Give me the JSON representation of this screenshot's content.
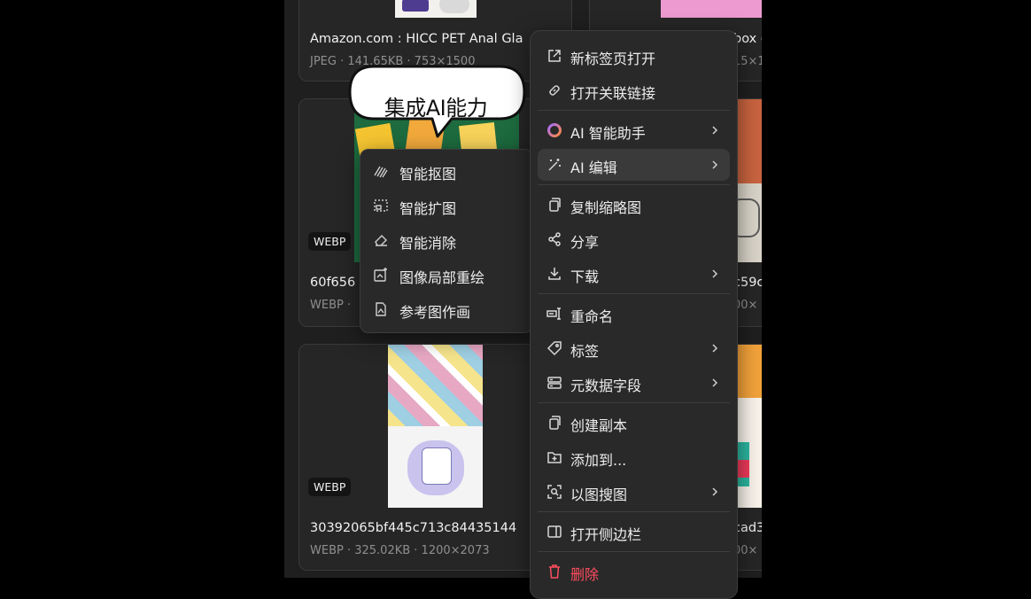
{
  "cards": [
    {
      "title": "Amazon.com : HICC PET Anal Gla",
      "meta": "JPEG · 141.65KB · 753×1500"
    },
    {
      "title": "60f656",
      "meta": "WEBP ·",
      "badge": "WEBP"
    },
    {
      "title": "30392065bf445c713c84435144",
      "meta": "WEBP · 325.02KB · 1200×2073",
      "badge": "WEBP"
    },
    {
      "title": "box c",
      "meta": "15×1"
    },
    {
      "title": "c59c",
      "meta": "00×"
    },
    {
      "title": "cad3",
      "meta": "00×"
    }
  ],
  "tooltip": {
    "label": "集成AI能力"
  },
  "context_menu": {
    "items": [
      {
        "label": "新标签页打开",
        "icon": "external-link-icon"
      },
      {
        "label": "打开关联链接",
        "icon": "link-icon"
      },
      {
        "label": "AI 智能助手",
        "icon": "ai-ring-icon"
      },
      {
        "label": "AI 编辑",
        "icon": "magic-wand-icon"
      },
      {
        "label": "复制缩略图",
        "icon": "copy-icon"
      },
      {
        "label": "分享",
        "icon": "share-icon"
      },
      {
        "label": "下载",
        "icon": "download-icon"
      },
      {
        "label": "重命名",
        "icon": "rename-icon"
      },
      {
        "label": "标签",
        "icon": "tag-icon"
      },
      {
        "label": "元数据字段",
        "icon": "metadata-icon"
      },
      {
        "label": "创建副本",
        "icon": "duplicate-icon"
      },
      {
        "label": "添加到...",
        "icon": "folder-add-icon"
      },
      {
        "label": "以图搜图",
        "icon": "image-search-icon"
      },
      {
        "label": "打开侧边栏",
        "icon": "sidebar-icon"
      },
      {
        "label": "删除",
        "icon": "trash-icon"
      }
    ]
  },
  "ai_submenu": {
    "items": [
      {
        "label": "智能抠图",
        "icon": "cutout-icon"
      },
      {
        "label": "智能扩图",
        "icon": "expand-image-icon"
      },
      {
        "label": "智能消除",
        "icon": "eraser-icon"
      },
      {
        "label": "图像局部重绘",
        "icon": "inpaint-icon"
      },
      {
        "label": "参考图作画",
        "icon": "reference-draw-icon"
      }
    ]
  },
  "colors": {
    "danger": "#ff4d5e",
    "highlight": "#3a3a3a",
    "menu_bg": "#292929"
  }
}
